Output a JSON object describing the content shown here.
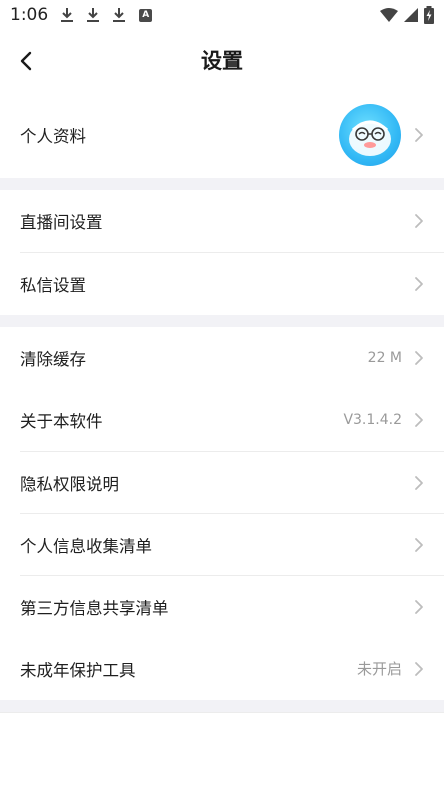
{
  "status_bar": {
    "time": "1:06",
    "icons": [
      "download-icon",
      "download-icon",
      "download-icon",
      "a-notification-icon",
      "wifi-icon",
      "signal-icon",
      "battery-charging-icon"
    ]
  },
  "header": {
    "title": "设置",
    "back_icon": "back-arrow-icon"
  },
  "profile": {
    "label": "个人资料",
    "avatar_icon": "cartoon-avatar"
  },
  "group1": [
    {
      "label": "直播间设置",
      "value": ""
    },
    {
      "label": "私信设置",
      "value": ""
    }
  ],
  "group2": [
    {
      "label": "清除缓存",
      "value": "22 M"
    },
    {
      "label": "关于本软件",
      "value": "V3.1.4.2"
    },
    {
      "label": "隐私权限说明",
      "value": ""
    },
    {
      "label": "个人信息收集清单",
      "value": ""
    },
    {
      "label": "第三方信息共享清单",
      "value": ""
    },
    {
      "label": "未成年保护工具",
      "value": "未开启"
    }
  ],
  "colors": {
    "section_gap": "#f2f2f6",
    "avatar_blue": "#33b9f5",
    "secondary_text": "#9a9a9a"
  }
}
